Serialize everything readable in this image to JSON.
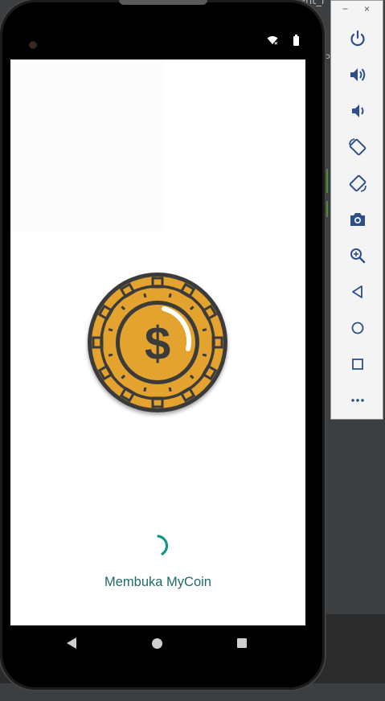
{
  "ide": {
    "top_text": "ent_r",
    "side_letter": "P"
  },
  "status_bar": {
    "wifi_icon": "wifi-off-icon",
    "battery_icon": "battery-full-icon"
  },
  "splash": {
    "logo": "dollar-coin-icon",
    "loading_text": "Membuka MyCoin",
    "accent_color": "#13968a",
    "coin_color": "#e4a22e"
  },
  "navbar": {
    "back": "back-icon",
    "home": "home-icon",
    "recents": "recents-icon"
  },
  "emulator_toolbar": {
    "minimize_label": "−",
    "close_label": "×",
    "buttons": [
      "power",
      "volume-up",
      "volume-down",
      "rotate-left",
      "rotate-right",
      "screenshot",
      "zoom",
      "back",
      "home",
      "overview",
      "more"
    ]
  }
}
